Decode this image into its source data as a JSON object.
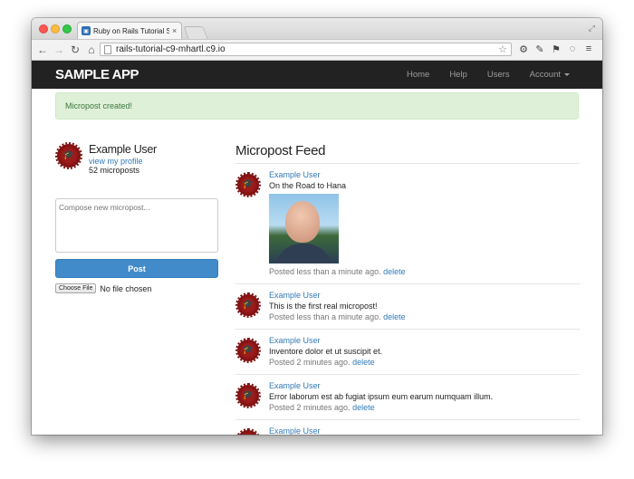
{
  "browser": {
    "tab_title": "Ruby on Rails Tutorial Sam",
    "tab_close": "×",
    "url": "rails-tutorial-c9-mhartl.c9.io"
  },
  "navbar": {
    "logo": "SAMPLE APP",
    "links": [
      "Home",
      "Help",
      "Users",
      "Account"
    ]
  },
  "flash": "Micropost created!",
  "sidebar": {
    "name": "Example User",
    "profile_link": "view my profile",
    "count": "52 microposts",
    "compose_placeholder": "Compose new micropost...",
    "post_button": "Post",
    "choose_file": "Choose File",
    "no_file": "No file chosen"
  },
  "feed": {
    "title": "Micropost Feed",
    "posts": [
      {
        "user": "Example User",
        "content": "On the Road to Hana",
        "time": "Posted less than a minute ago.",
        "delete": "delete"
      },
      {
        "user": "Example User",
        "content": "This is the first real micropost!",
        "time": "Posted less than a minute ago.",
        "delete": "delete"
      },
      {
        "user": "Example User",
        "content": "Inventore dolor et ut suscipit et.",
        "time": "Posted 2 minutes ago.",
        "delete": "delete"
      },
      {
        "user": "Example User",
        "content": "Error laborum est ab fugiat ipsum eum earum numquam illum.",
        "time": "Posted 2 minutes ago.",
        "delete": "delete"
      },
      {
        "user": "Example User"
      }
    ]
  }
}
